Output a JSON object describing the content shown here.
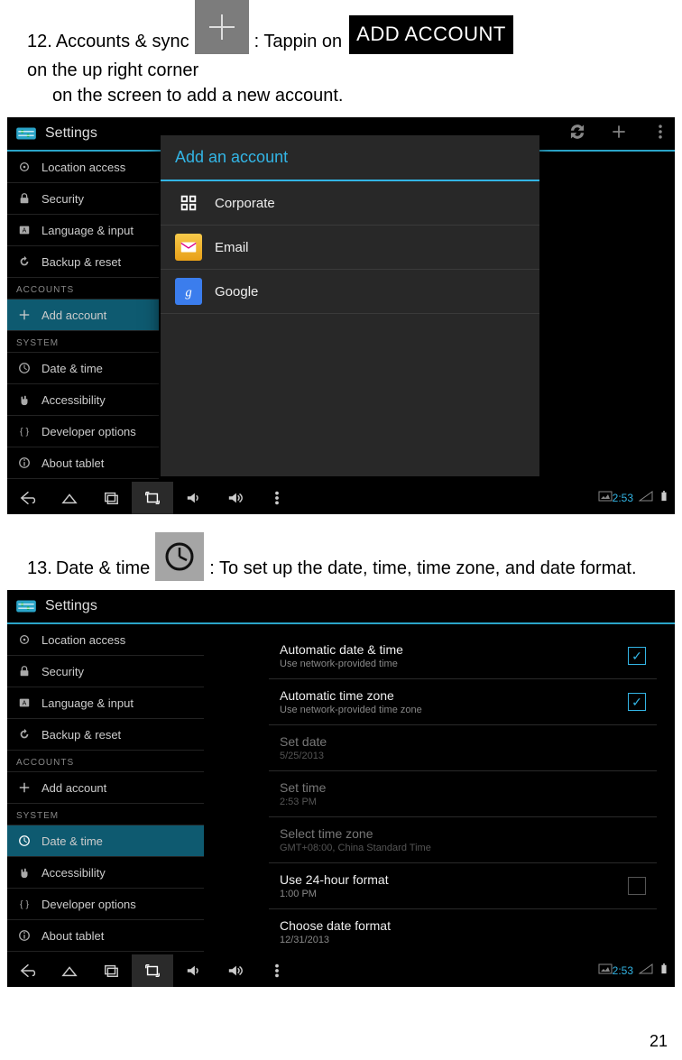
{
  "doc": {
    "item12_num": "12.",
    "item12_a": "Accounts & sync",
    "item12_b": ": Tappin on",
    "add_account_btn": "ADD ACCOUNT",
    "item12_c": "on the up right corner",
    "item12_d": "on the screen to add a new account.",
    "item13_num": "13.",
    "item13_a": "Date & time",
    "item13_b": ": To set up the date, time, time zone, and date format."
  },
  "settings_title": "Settings",
  "sidebar": {
    "location": "Location access",
    "security": "Security",
    "lang": "Language & input",
    "backup": "Backup & reset",
    "hdr_accounts": "ACCOUNTS",
    "add_account": "Add account",
    "hdr_system": "SYSTEM",
    "date_time": "Date & time",
    "accessibility": "Accessibility",
    "dev": "Developer options",
    "about": "About tablet"
  },
  "dialog": {
    "title": "Add an account",
    "corporate": "Corporate",
    "email": "Email",
    "google": "Google"
  },
  "datetime": {
    "auto_dt": "Automatic date & time",
    "auto_dt_sub": "Use network-provided time",
    "auto_tz": "Automatic time zone",
    "auto_tz_sub": "Use network-provided time zone",
    "set_date": "Set date",
    "set_date_sub": "5/25/2013",
    "set_time": "Set time",
    "set_time_sub": "2:53 PM",
    "sel_tz": "Select time zone",
    "sel_tz_sub": "GMT+08:00, China Standard Time",
    "use_24": "Use 24-hour format",
    "use_24_sub": "1:00 PM",
    "choose_fmt": "Choose date format",
    "choose_fmt_sub": "12/31/2013"
  },
  "nav_time": "2:53",
  "page_number": "21"
}
